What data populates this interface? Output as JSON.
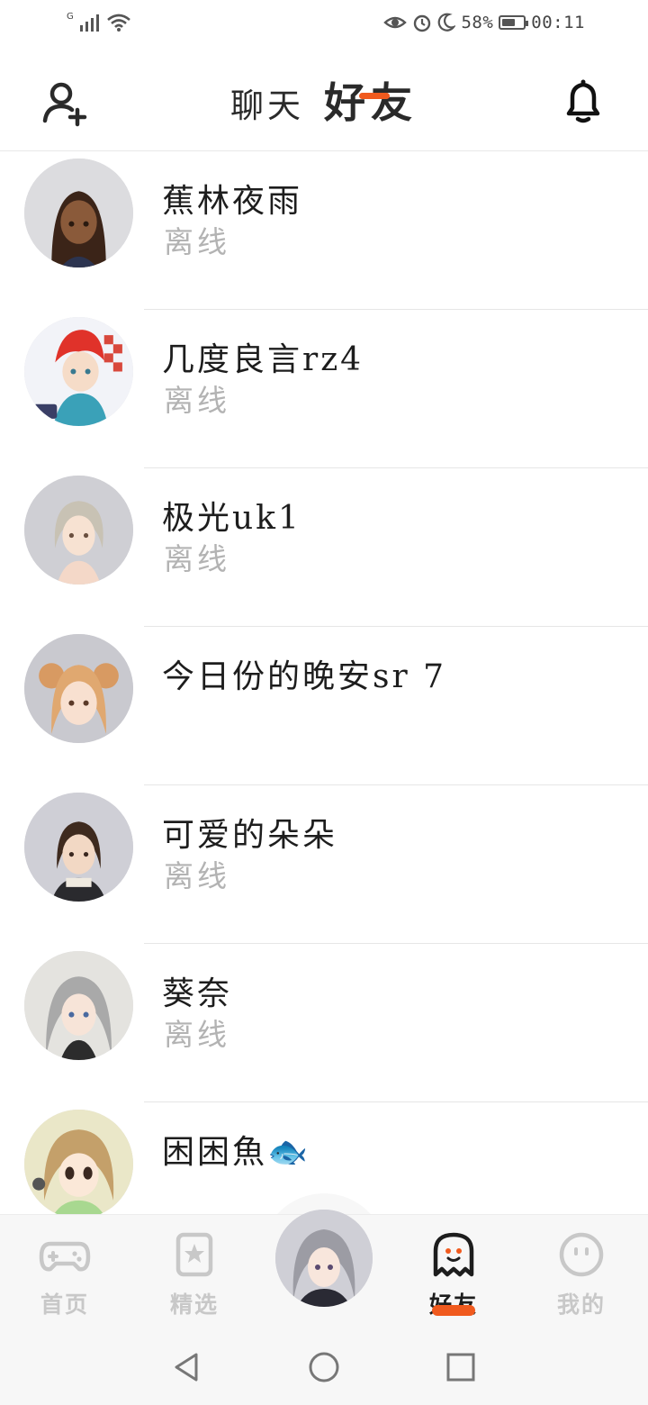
{
  "status_bar": {
    "network": "G",
    "battery": "58%",
    "time": "00:11",
    "icons": [
      "signal-icon",
      "wifi-icon",
      "eye-comfort-icon",
      "alarm-icon",
      "moon-icon",
      "battery-icon"
    ]
  },
  "header": {
    "tabs": [
      {
        "label": "聊天",
        "active": false
      },
      {
        "label": "好友",
        "active": true
      }
    ],
    "accent_color": "#f05a1e"
  },
  "friends": [
    {
      "name": "蕉林夜雨",
      "status": "离线",
      "avatar": "avatar-dark-hair-girl"
    },
    {
      "name": "几度良言rz4",
      "status": "离线",
      "avatar": "avatar-red-hair-boy"
    },
    {
      "name": "极光uk1",
      "status": "离线",
      "avatar": "avatar-silver-bun-girl"
    },
    {
      "name": "今日份的晚安sr 7",
      "status": "",
      "avatar": "avatar-orange-bun-girl"
    },
    {
      "name": "可爱的朵朵",
      "status": "离线",
      "avatar": "avatar-short-brown-hair"
    },
    {
      "name": "葵奈",
      "status": "离线",
      "avatar": "avatar-gray-hair-girl"
    },
    {
      "name": "困困魚🐟",
      "status": "",
      "avatar": "avatar-brown-bob-girl"
    }
  ],
  "bottom_nav": {
    "items": [
      {
        "label": "首页",
        "icon": "gamepad-icon",
        "active": false
      },
      {
        "label": "精选",
        "icon": "star-bookmark-icon",
        "active": false
      },
      {
        "label": "好友",
        "icon": "ghost-icon",
        "active": true
      },
      {
        "label": "我的",
        "icon": "smiley-icon",
        "active": false
      }
    ]
  }
}
